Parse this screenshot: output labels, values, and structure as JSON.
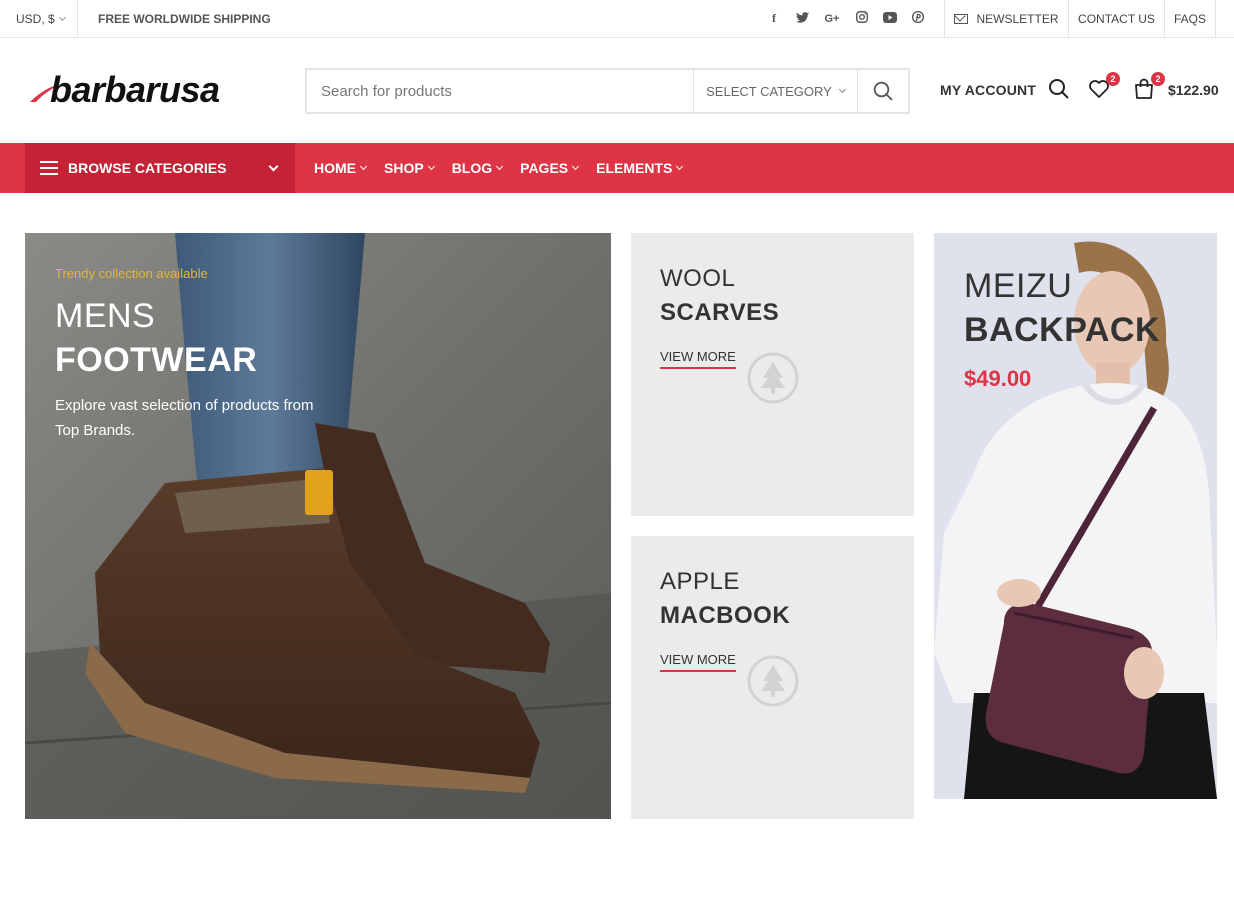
{
  "topbar": {
    "currency": "USD, $",
    "shipping": "FREE WORLDWIDE SHIPPING",
    "socials": [
      {
        "icon": "facebook-icon",
        "glyph": "f"
      },
      {
        "icon": "twitter-icon",
        "glyph": "t"
      },
      {
        "icon": "google-plus-icon",
        "glyph": "G+"
      },
      {
        "icon": "instagram-icon",
        "glyph": "◎"
      },
      {
        "icon": "youtube-icon",
        "glyph": "▶"
      },
      {
        "icon": "pinterest-icon",
        "glyph": "P"
      }
    ],
    "newsletter": "NEWSLETTER",
    "contact": "CONTACT US",
    "faqs": "FAQS"
  },
  "header": {
    "logo": "barbarusa",
    "search_placeholder": "Search for products",
    "category_select": "SELECT CATEGORY",
    "my_account": "MY ACCOUNT",
    "wishlist_count": "2",
    "cart_count": "2",
    "cart_total": "$122.90"
  },
  "nav": {
    "browse": "BROWSE CATEGORIES",
    "items": [
      {
        "label": "HOME"
      },
      {
        "label": "SHOP"
      },
      {
        "label": "BLOG"
      },
      {
        "label": "PAGES"
      },
      {
        "label": "ELEMENTS"
      }
    ]
  },
  "banners": {
    "main": {
      "kicker": "Trendy collection available",
      "title_light": "MENS",
      "title_bold": "FOOTWEAR",
      "description": "Explore vast selection of products from Top Brands."
    },
    "scarves": {
      "title_light": "WOOL",
      "title_bold": "SCARVES",
      "cta": "VIEW MORE"
    },
    "macbook": {
      "title_light": "APPLE",
      "title_bold": "MACBOOK",
      "cta": "VIEW MORE"
    },
    "backpack": {
      "title_light": "MEIZU",
      "title_bold": "BACKPACK",
      "price": "$49.00"
    }
  },
  "colors": {
    "accent": "#dd3446",
    "accent_dark": "#c42336",
    "kicker": "#e7b53a"
  }
}
